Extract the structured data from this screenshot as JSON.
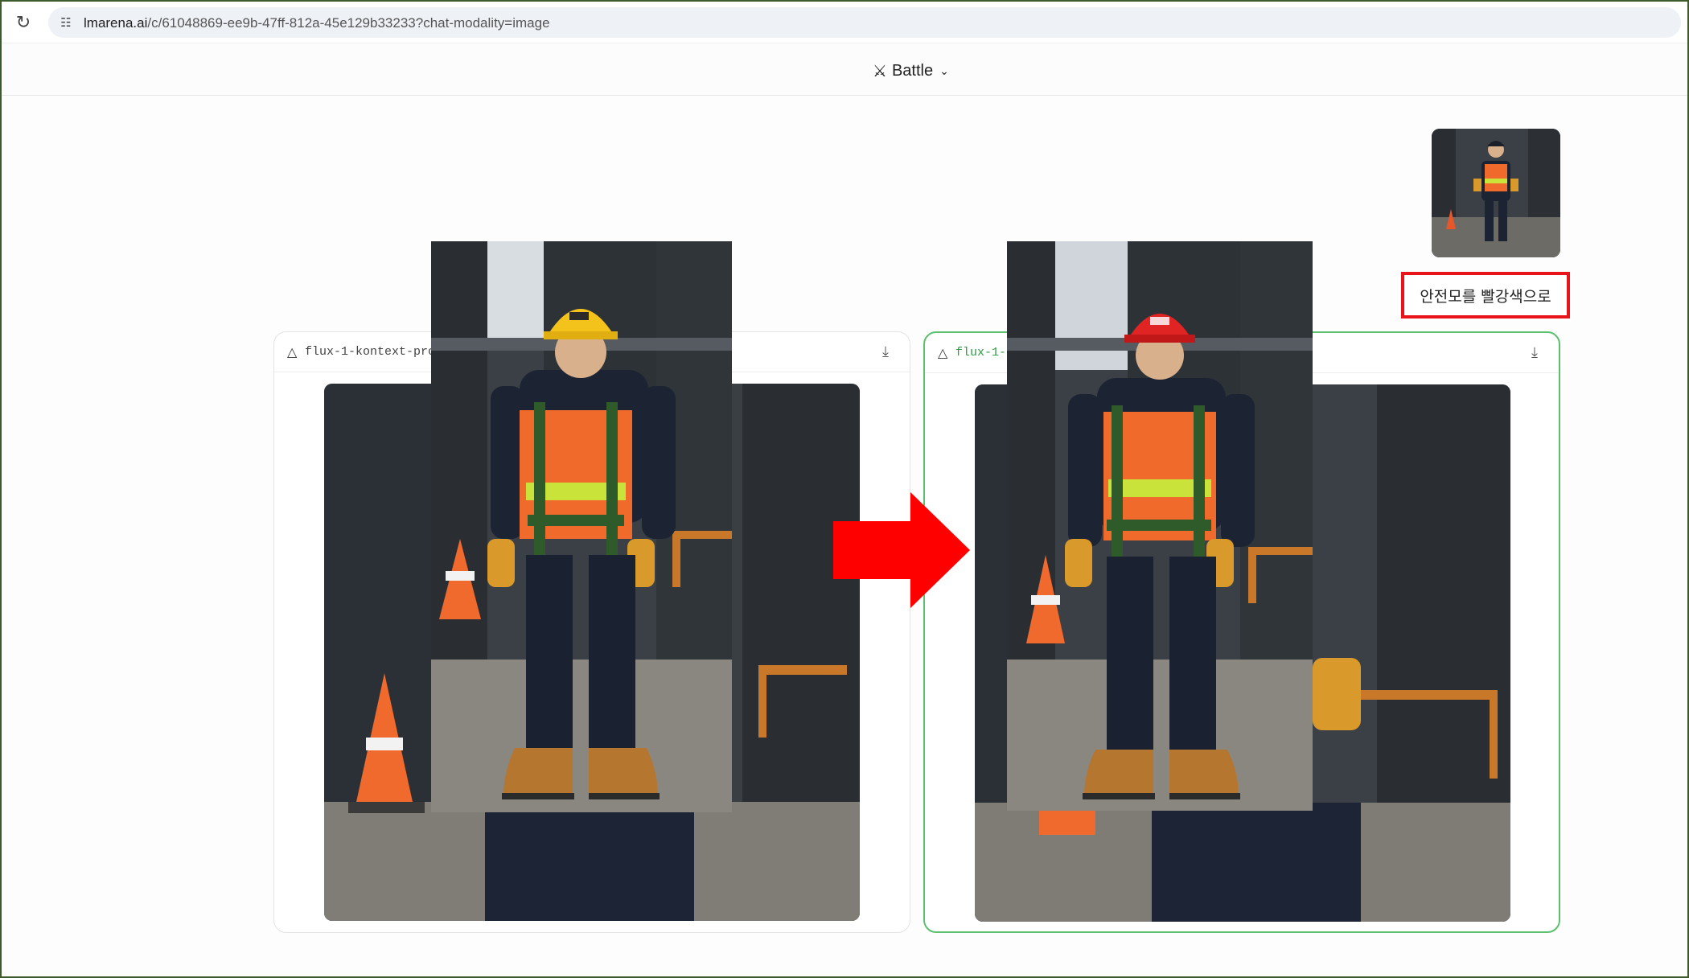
{
  "browser": {
    "url_host": "lmarena.ai",
    "url_rest": "/c/61048869-ee9b-47ff-812a-45e129b33233?chat-modality=image",
    "reload_icon": "reload-icon",
    "site_icon": "site-settings-icon"
  },
  "header": {
    "mode_label": "Battle",
    "mode_icon": "swords-icon",
    "chevron_icon": "chevron-down-icon"
  },
  "user_message": {
    "prompt": "안전모를 빨강색으로",
    "highlight_color": "#e8141a"
  },
  "responses": [
    {
      "model_name": "flux-1-kontext-pro",
      "helmet_color": "#f3c21b",
      "selected": false
    },
    {
      "model_name": "flux-1-",
      "helmet_color": "#e02424",
      "selected": true,
      "accent": "#5cc06f"
    }
  ],
  "arrow_color": "#ff0000"
}
